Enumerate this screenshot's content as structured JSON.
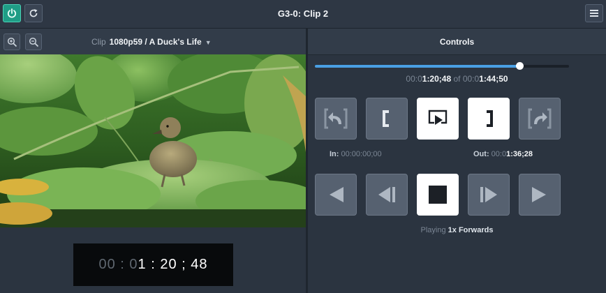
{
  "window": {
    "title": "G3-0: Clip 2"
  },
  "topbar": {
    "power_icon": "power-icon",
    "redo_icon": "redo-icon",
    "menu_icon": "hamburger-menu-icon"
  },
  "toolbar": {
    "clip_label": "Clip",
    "clip_value": "1080p59 / A Duck's Life",
    "zoom_in_icon": "zoom-in-icon",
    "zoom_out_icon": "zoom-out-icon"
  },
  "video": {
    "subject": "duckling on lily pads"
  },
  "timecode": {
    "dim": "00 : 0",
    "bright": "1 : 20 ; 48"
  },
  "controls": {
    "title": "Controls",
    "progress": 0.8043,
    "position_dim": "00:0",
    "position_bright": "1:20;48",
    "of_label": "of",
    "duration_dim": "00:0",
    "duration_bright": "1:44;50",
    "in_label": "In:",
    "in_value": "00:00:00;00",
    "out_label": "Out:",
    "out_dim": "00:0",
    "out_bright": "1:36;28",
    "status_label": "Playing",
    "status_value": "1x Forwards",
    "buttons": [
      {
        "icon": "undo-arrow-icon",
        "active": false
      },
      {
        "icon": "mark-in-bracket-icon",
        "active": false
      },
      {
        "icon": "play-region-icon",
        "active": true
      },
      {
        "icon": "mark-out-bracket-icon",
        "active": true
      },
      {
        "icon": "redo-arrow-icon",
        "active": false
      },
      {
        "icon": "rewind-icon",
        "active": false
      },
      {
        "icon": "step-back-icon",
        "active": false
      },
      {
        "icon": "stop-icon",
        "active": true
      },
      {
        "icon": "step-forward-icon",
        "active": false
      },
      {
        "icon": "fast-forward-icon",
        "active": false
      }
    ]
  },
  "colors": {
    "accent": "#1f9d86",
    "progress": "#4a9fe4",
    "panel": "#2b3440"
  }
}
